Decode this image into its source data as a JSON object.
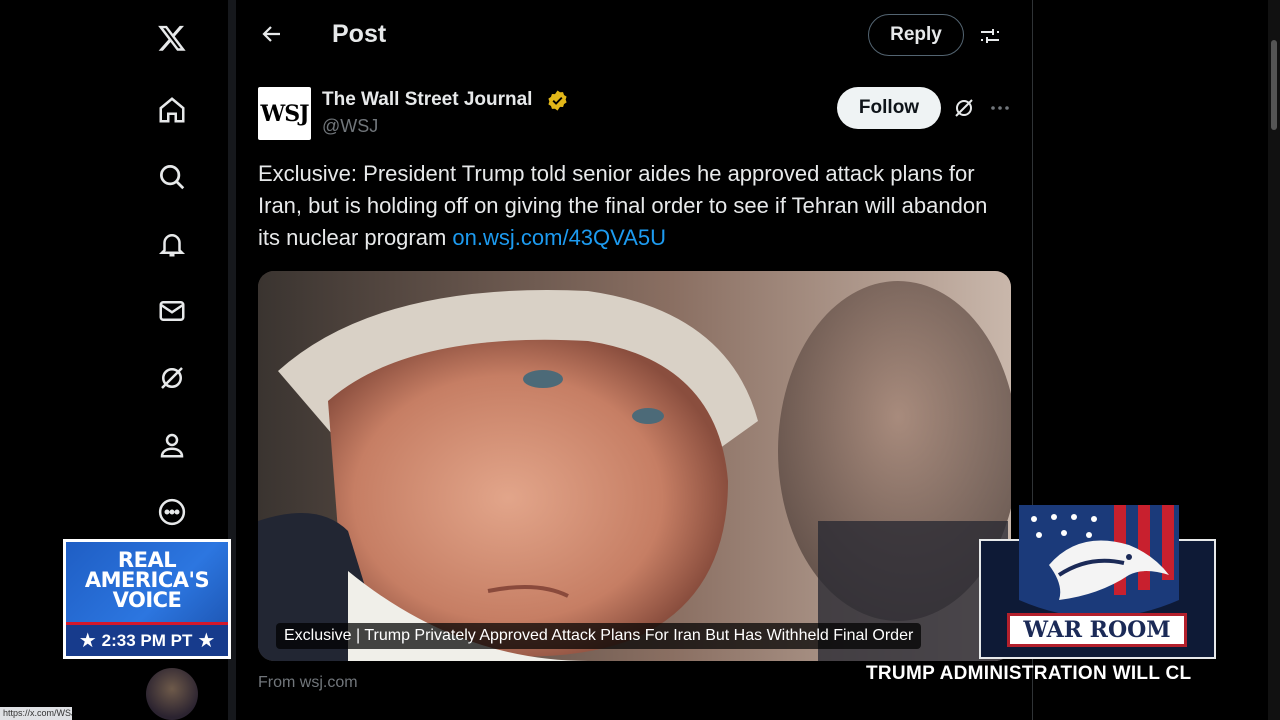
{
  "nav": {
    "items": [
      {
        "name": "x-logo",
        "icon": "x-logo-icon"
      },
      {
        "name": "home",
        "icon": "home-icon"
      },
      {
        "name": "explore",
        "icon": "search-icon"
      },
      {
        "name": "notifications",
        "icon": "bell-icon"
      },
      {
        "name": "messages",
        "icon": "mail-icon"
      },
      {
        "name": "grok",
        "icon": "grok-icon"
      },
      {
        "name": "profile",
        "icon": "person-icon"
      },
      {
        "name": "more",
        "icon": "more-circle-icon"
      }
    ]
  },
  "header": {
    "title": "Post",
    "reply_label": "Reply"
  },
  "post": {
    "avatar_text": "WSJ",
    "author_name": "The Wall Street Journal",
    "handle": "@WSJ",
    "follow_label": "Follow",
    "text": "Exclusive: President Trump told senior aides he approved attack plans for Iran, but is holding off on giving the final order to see if Tehran will abandon its nuclear program ",
    "link": "on.wsj.com/43QVA5U",
    "media_caption": "Exclusive | Trump Privately Approved Attack Plans For Iran But Has Withheld Final Order",
    "media_source": "From wsj.com"
  },
  "overlays": {
    "rav_brand": "REAL AMERICA'S VOICE",
    "rav_time": "2:33 PM PT",
    "warroom_label": "WAR ROOM",
    "ticker": "TRUMP ADMINISTRATION WILL CL"
  },
  "statusbar": {
    "url": "https://x.com/WSJ"
  },
  "colors": {
    "link": "#1d9bf0",
    "verified": "#e2b719",
    "background": "#000000"
  }
}
